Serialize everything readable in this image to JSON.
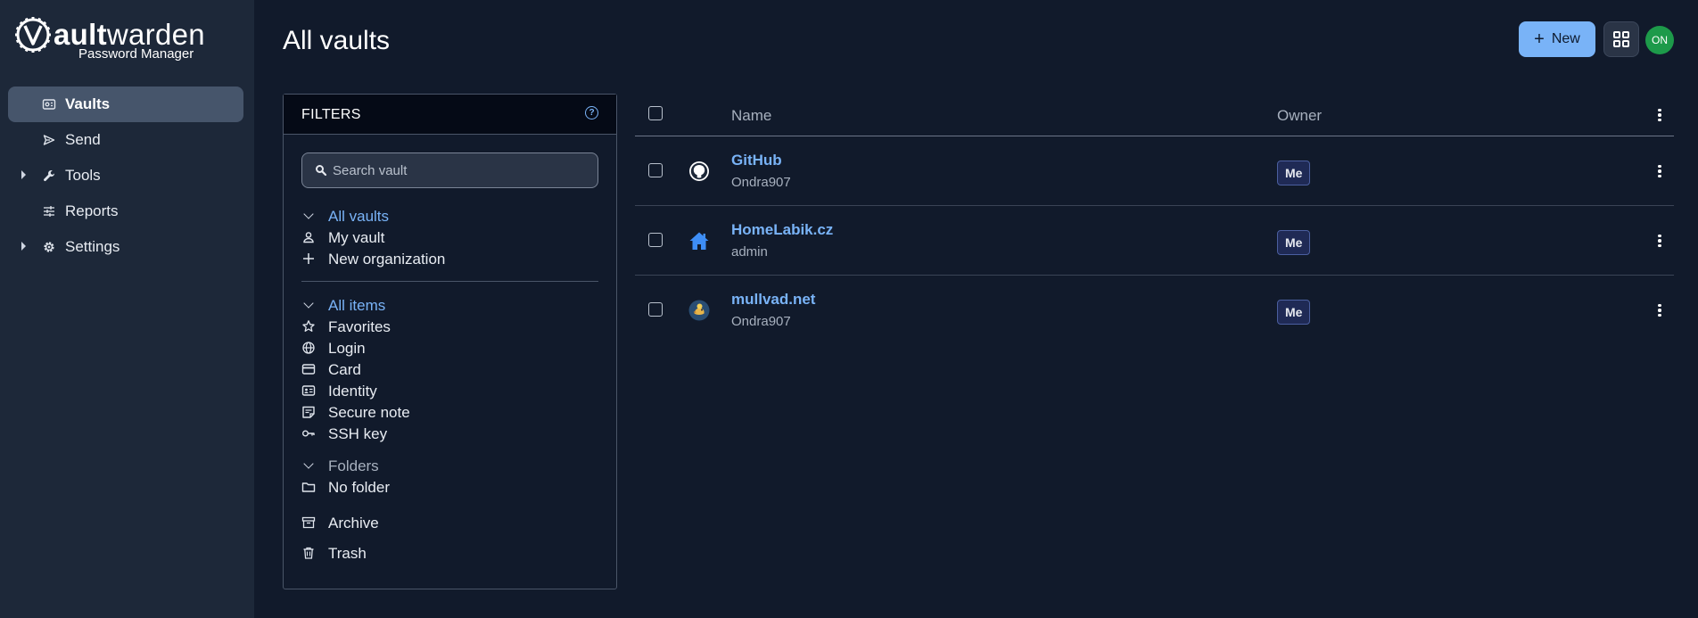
{
  "app": {
    "logo_bold": "ault",
    "logo_light": "warden",
    "logo_sub": "Password Manager"
  },
  "sidebar": {
    "items": [
      {
        "label": "Vaults",
        "icon": "vault-icon",
        "active": true,
        "expandable": false
      },
      {
        "label": "Send",
        "icon": "send-icon",
        "active": false,
        "expandable": false
      },
      {
        "label": "Tools",
        "icon": "wrench-icon",
        "active": false,
        "expandable": true
      },
      {
        "label": "Reports",
        "icon": "sliders-icon",
        "active": false,
        "expandable": false
      },
      {
        "label": "Settings",
        "icon": "gear-icon",
        "active": false,
        "expandable": true
      }
    ]
  },
  "header": {
    "title": "All vaults",
    "new_label": "New",
    "avatar_initials": "ON"
  },
  "filters": {
    "title": "FILTERS",
    "search_placeholder": "Search vault",
    "vaults": {
      "header": "All vaults",
      "items": [
        "My vault",
        "New organization"
      ]
    },
    "types": {
      "header": "All items",
      "items": [
        "Favorites",
        "Login",
        "Card",
        "Identity",
        "Secure note",
        "SSH key"
      ]
    },
    "folders": {
      "header": "Folders",
      "items": [
        "No folder"
      ]
    },
    "archive": "Archive",
    "trash": "Trash"
  },
  "table": {
    "col_name": "Name",
    "col_owner": "Owner",
    "rows": [
      {
        "name": "GitHub",
        "sub": "Ondra907",
        "owner": "Me",
        "icon": "github-icon"
      },
      {
        "name": "HomeLabik.cz",
        "sub": "admin",
        "owner": "Me",
        "icon": "home-icon"
      },
      {
        "name": "mullvad.net",
        "sub": "Ondra907",
        "owner": "Me",
        "icon": "mullvad-icon"
      }
    ]
  },
  "colors": {
    "accent": "#79b3f7",
    "sidebar_bg": "#1d2839",
    "page_bg": "#111a2b",
    "avatar": "#1d9a4a"
  }
}
